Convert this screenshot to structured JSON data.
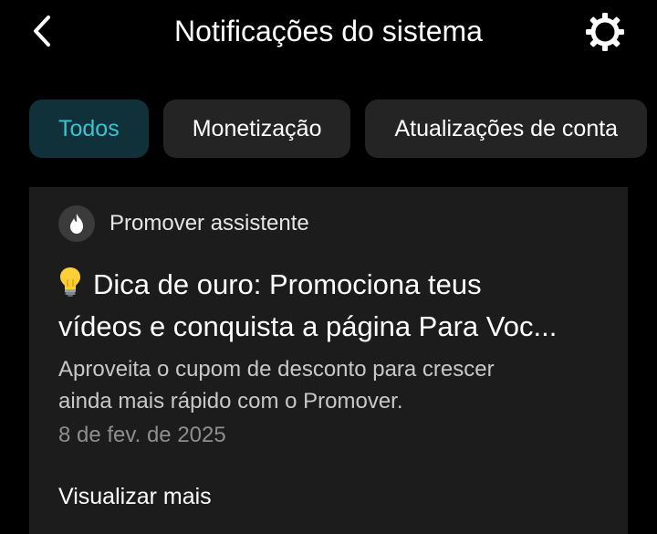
{
  "header": {
    "title": "Notificações do sistema",
    "back_icon": "chevron-left-icon",
    "settings_icon": "gear-icon"
  },
  "tabs": [
    {
      "label": "Todos",
      "active": true
    },
    {
      "label": "Monetização",
      "active": false
    },
    {
      "label": "Atualizações de conta",
      "active": false
    }
  ],
  "notification": {
    "sender": "Promover assistente",
    "sender_icon": "flame-icon",
    "headline_icon": "lightbulb-icon",
    "headline_line1": "Dica de ouro: Promociona teus",
    "headline_line2": "vídeos e conquista a página Para Voc...",
    "body_line1": "Aproveita o cupom de desconto para crescer",
    "body_line2": "ainda mais rápido com o Promover.",
    "date": "8 de fev. de 2025",
    "more_label": "Visualizar mais"
  },
  "colors": {
    "background": "#000000",
    "tab_background": "#242424",
    "tab_active_background": "#10313a",
    "tab_active_text": "#3cc3cf",
    "card_background": "#1c1c1c"
  }
}
